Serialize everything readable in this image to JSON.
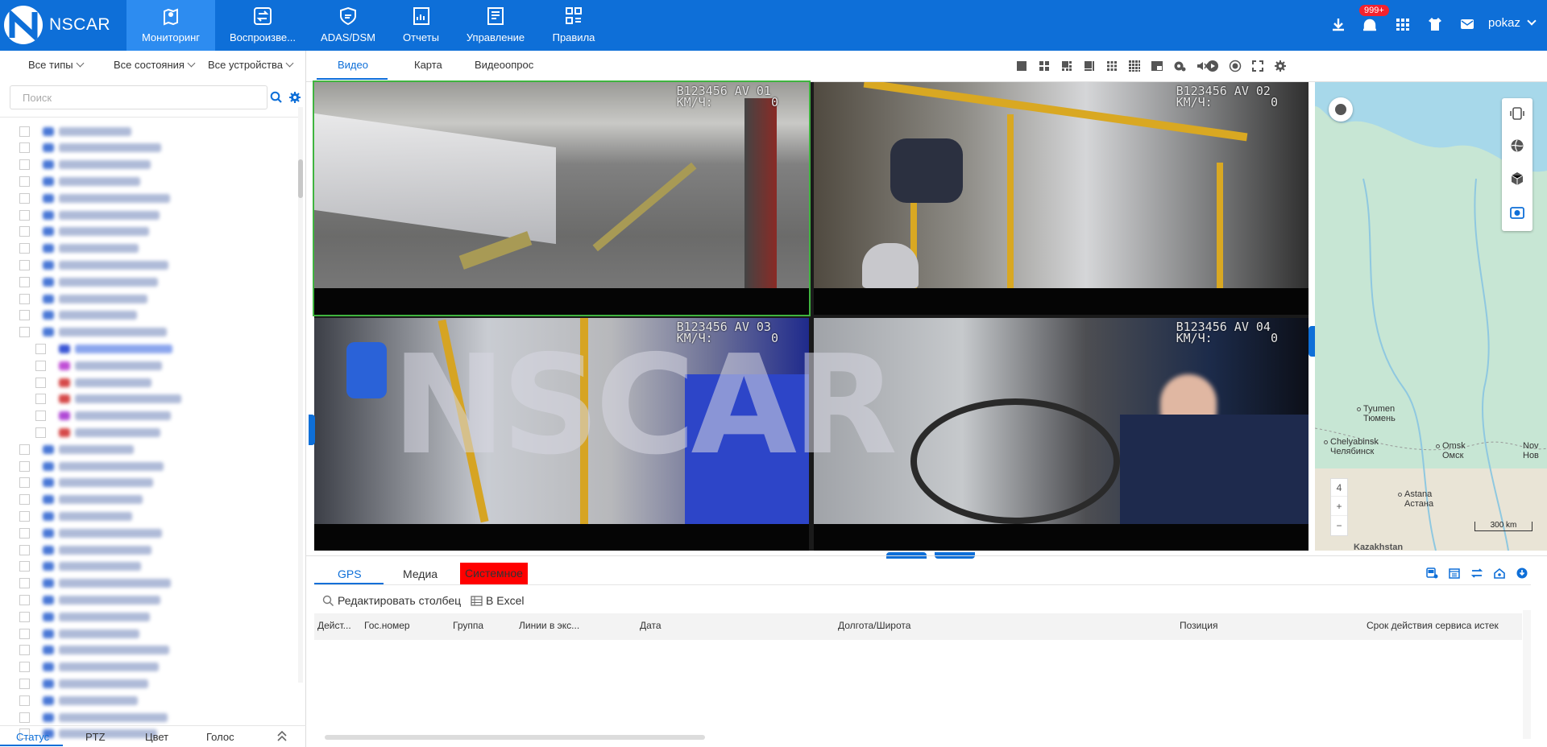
{
  "app": {
    "brand": "NSCAR"
  },
  "nav": [
    {
      "label": "Мониторинг",
      "icon": "map-pin-icon",
      "active": true
    },
    {
      "label": "Воспроизве...",
      "icon": "playback-icon"
    },
    {
      "label": "ADAS/DSM",
      "icon": "shield-icon"
    },
    {
      "label": "Отчеты",
      "icon": "report-icon"
    },
    {
      "label": "Управление",
      "icon": "manage-icon"
    },
    {
      "label": "Правила",
      "icon": "rules-icon"
    }
  ],
  "header": {
    "badge": "999+",
    "user": "pokaz",
    "icons": [
      "download-icon",
      "alarm-icon",
      "grid-icon",
      "shirt-icon",
      "mail-icon"
    ]
  },
  "sidebar": {
    "filters": [
      "Все типы",
      "Все состояния",
      "Все устройства"
    ],
    "search_placeholder": "Поиск",
    "tabs": [
      "Статус",
      "PTZ",
      "Цвет",
      "Голос"
    ]
  },
  "main": {
    "tabs": [
      "Видео",
      "Карта",
      "Видеоопрос"
    ],
    "active_tab": "Видео"
  },
  "video": {
    "cells": [
      {
        "plate": "B123456 AV 01",
        "speed": "КМ/Ч:        0"
      },
      {
        "plate": "B123456 AV 02",
        "speed": "КМ/Ч:        0"
      },
      {
        "plate": "B123456 AV 03",
        "speed": "КМ/Ч:        0"
      },
      {
        "plate": "B123456 AV 04",
        "speed": "КМ/Ч:        0"
      }
    ],
    "watermark": "NSCAR"
  },
  "map": {
    "cities": [
      {
        "en": "Tyumen",
        "ru": "Тюмень"
      },
      {
        "en": "Chelyabinsk",
        "ru": "Челябинск"
      },
      {
        "en": "Omsk",
        "ru": "Омск"
      },
      {
        "en": "Nov",
        "ru": "Нов"
      },
      {
        "en": "Astana",
        "ru": "Астана"
      },
      {
        "en": "Kazakhstan",
        "ru": ""
      }
    ],
    "zoom": "4",
    "zoom_in": "+",
    "zoom_out": "−",
    "scale": "300 km"
  },
  "bottom": {
    "tabs": [
      "GPS",
      "Медиа",
      "Системное"
    ],
    "actions": [
      "Редактировать столбец",
      "В Excel"
    ],
    "columns": [
      "Дейст...",
      "Гос.номер",
      "Группа",
      "Линии в экс...",
      "Дата",
      "Долгота/Широта",
      "Позиция",
      "Срок действия сервиса истек"
    ]
  }
}
